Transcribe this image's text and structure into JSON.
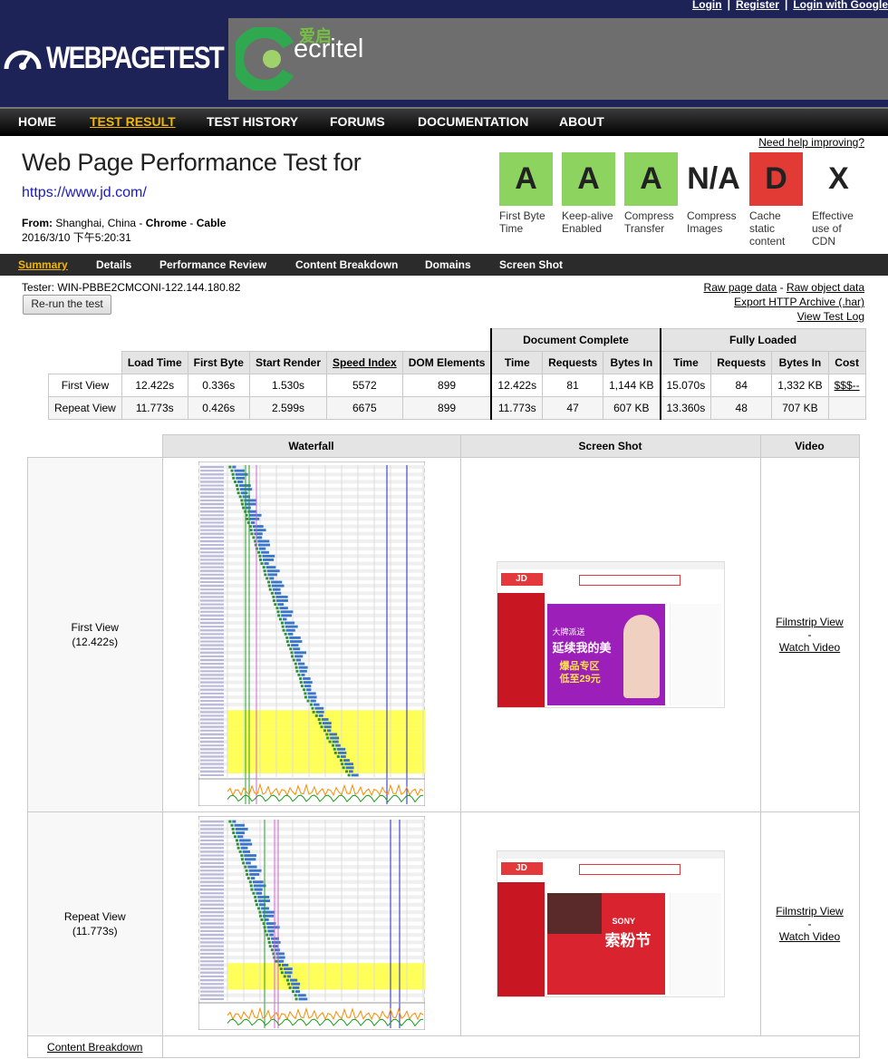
{
  "toplinks": {
    "login": "Login",
    "register": "Register",
    "login_google": "Login with Google",
    "sep": "|"
  },
  "brand": {
    "logo_text": "WEBPAGETEST",
    "sponsor": "ecritel",
    "sponsor_cn": "爱启"
  },
  "nav": [
    "HOME",
    "TEST RESULT",
    "TEST HISTORY",
    "FORUMS",
    "DOCUMENTATION",
    "ABOUT"
  ],
  "page": {
    "title": "Web Page Performance Test for",
    "url": "https://www.jd.com/",
    "from_label": "From:",
    "from_location": "Shanghai, China",
    "from_browser": "Chrome",
    "from_connection": "Cable",
    "datetime": "2016/3/10 下午5:20:31",
    "help": "Need help improving?"
  },
  "grades": [
    {
      "grade": "A",
      "label": "First Byte Time",
      "color": "#8dd35f"
    },
    {
      "grade": "A",
      "label": "Keep-alive Enabled",
      "color": "#8dd35f"
    },
    {
      "grade": "A",
      "label": "Compress Transfer",
      "color": "#8dd35f"
    },
    {
      "grade": "N/A",
      "label": "Compress Images",
      "color": ""
    },
    {
      "grade": "D",
      "label": "Cache static content",
      "color": "#e23a35"
    },
    {
      "grade": "X",
      "label": "Effective use of CDN",
      "color": ""
    }
  ],
  "subnav": [
    "Summary",
    "Details",
    "Performance Review",
    "Content Breakdown",
    "Domains",
    "Screen Shot"
  ],
  "tester": "Tester: WIN-PBBE2CMCONI-122.144.180.82",
  "rerun": "Re-run the test",
  "result_links": {
    "raw_page": "Raw page data",
    "dash": " - ",
    "raw_object": "Raw object data",
    "export_har": "Export HTTP Archive (.har)",
    "test_log": "View Test Log"
  },
  "results": {
    "group_headers": {
      "doc_complete": "Document Complete",
      "fully_loaded": "Fully Loaded"
    },
    "headers": [
      "Load Time",
      "First Byte",
      "Start Render",
      "Speed Index",
      "DOM Elements",
      "Time",
      "Requests",
      "Bytes In",
      "Time",
      "Requests",
      "Bytes In",
      "Cost"
    ],
    "rows": [
      {
        "label": "First View",
        "values": [
          "12.422s",
          "0.336s",
          "1.530s",
          "5572",
          "899",
          "12.422s",
          "81",
          "1,144 KB",
          "15.070s",
          "84",
          "1,332 KB",
          "$$$--"
        ]
      },
      {
        "label": "Repeat View",
        "values": [
          "11.773s",
          "0.426s",
          "2.599s",
          "6675",
          "899",
          "11.773s",
          "47",
          "607 KB",
          "13.360s",
          "48",
          "707 KB",
          ""
        ]
      }
    ]
  },
  "views": {
    "headers": {
      "waterfall": "Waterfall",
      "screenshot": "Screen Shot",
      "video": "Video"
    },
    "first": {
      "label": "First View",
      "time": "(12.422s)"
    },
    "repeat": {
      "label": "Repeat View",
      "time": "(11.773s)"
    },
    "filmstrip": "Filmstrip View",
    "dash": "-",
    "watch": "Watch Video",
    "breakdown": "Content Breakdown"
  },
  "screenshot_text": {
    "first_banner_1": "大牌派送",
    "first_banner_2": "延续我的美",
    "first_banner_3": "爆品专区",
    "first_banner_4": "低至29元",
    "repeat_banner_1": "SONY",
    "repeat_banner_2": "索粉节"
  }
}
